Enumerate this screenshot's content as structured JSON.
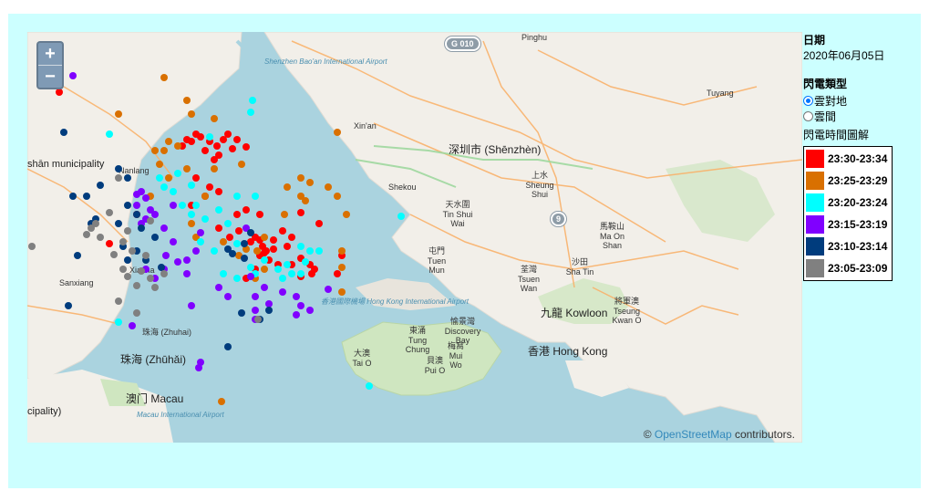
{
  "map": {
    "zoom_in": "+",
    "zoom_out": "−",
    "attribution_prefix": "© ",
    "attribution_link": "OpenStreetMap",
    "attribution_suffix": " contributors.",
    "labels": {
      "pinghu": "Pinghu",
      "shenzhen_airport": "Shenzhen Bao'an International Airport",
      "tuyang": "Tuyang",
      "xinan": "Xin'an",
      "shenzhen": "深圳市 (Shēnzhèn)",
      "sheung_shui": "上水 Sheung Shui",
      "shekou": "Shekou",
      "tin_shui_wai": "天水圍 Tin Shui Wai",
      "tuen_mun": "屯門 Tuen Mun",
      "tsuen_wan": "荃灣 Tsuen Wan",
      "sha_tin": "沙田 Sha Tin",
      "ma_on_shan": "馬鞍山 Ma On Shan",
      "tseung_kwan_o": "將軍澳 Tseung Kwan O",
      "kowloon": "九龍 Kowloon",
      "hong_kong": "香港 Hong Kong",
      "hk_airport": "香港國際機場 Hong Kong International Airport",
      "tung_chung": "東涌 Tung Chung",
      "discovery_bay": "愉景灣 Discovery Bay",
      "mui_wo": "梅窩 Mui Wo",
      "tai_o": "大澳 Tai O",
      "pui_o": "貝澳 Pui O",
      "zhuhai_small": "珠海 (Zhuhai)",
      "zhuhai": "珠海 (Zhūhǎi)",
      "macau": "澳门 Macau",
      "macau_airport": "Macau International Airport",
      "nanlang": "Nanlang",
      "xiazha": "Xiazha",
      "sanxiang": "Sanxiang",
      "municipality": "shān municipality",
      "cipality": "cipality)",
      "g010": "G 010",
      "route9": "9"
    }
  },
  "panel": {
    "date_heading": "日期",
    "date_value": "2020年06月05日",
    "type_heading": "閃電類型",
    "radio_cg": "雲對地",
    "radio_cc": "雲間",
    "legend_heading": "閃電時間圖解"
  },
  "legend": [
    {
      "label": "23:30-23:34",
      "color": "#ff0000"
    },
    {
      "label": "23:25-23:29",
      "color": "#d97000"
    },
    {
      "label": "23:20-23:24",
      "color": "#00ffff"
    },
    {
      "label": "23:15-23:19",
      "color": "#8000ff"
    },
    {
      "label": "23:10-23:14",
      "color": "#003c7d"
    },
    {
      "label": "23:05-23:09",
      "color": "#808080"
    }
  ]
}
